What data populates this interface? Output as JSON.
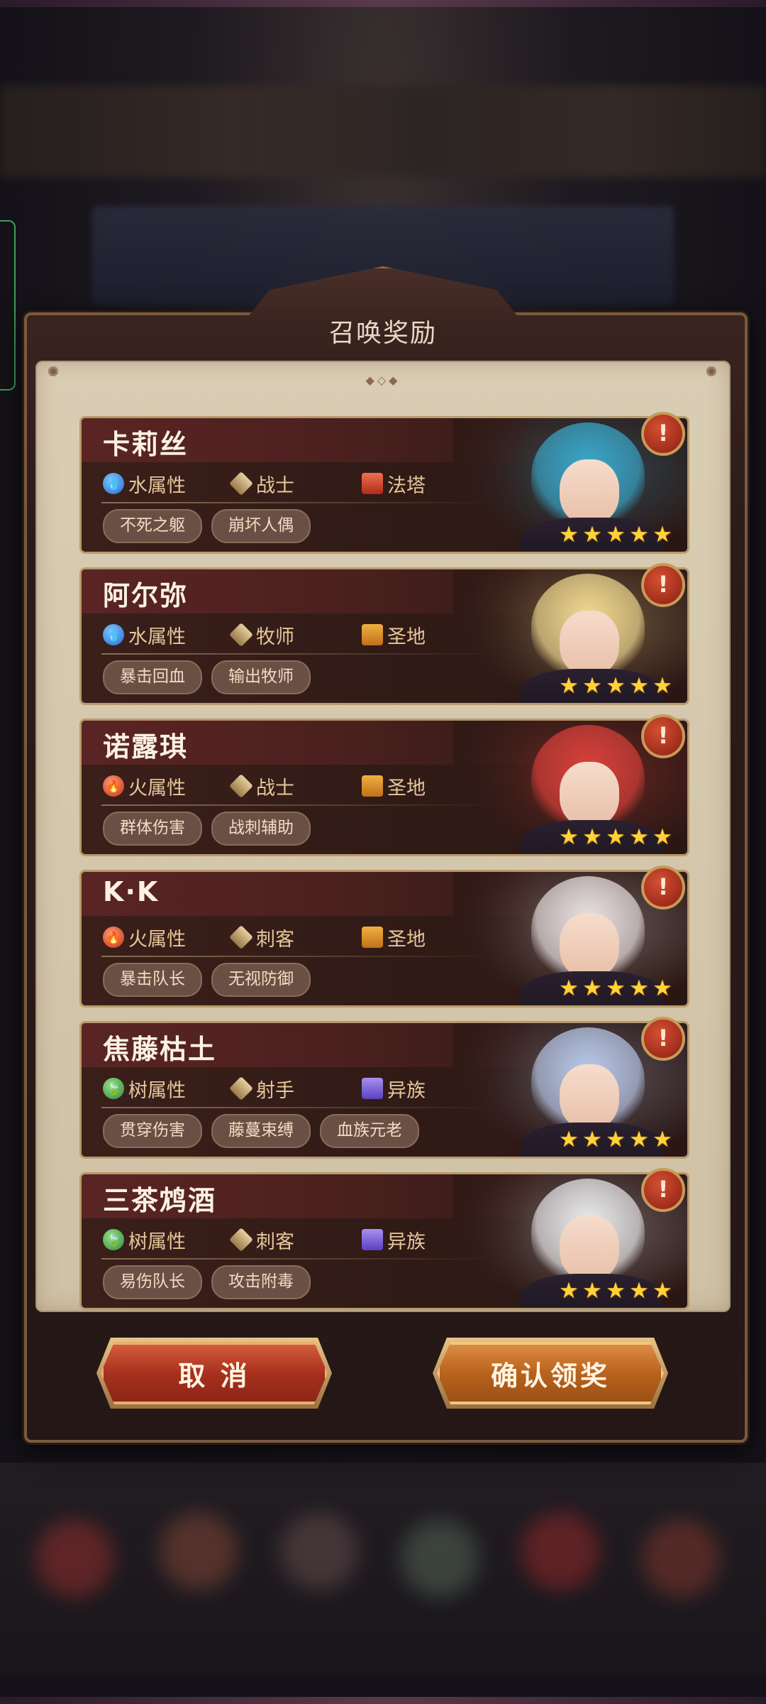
{
  "dialog": {
    "title": "召唤奖励",
    "cancel_label": "取 消",
    "confirm_label": "确认领奖"
  },
  "heroes": [
    {
      "name": "卡莉丝",
      "element": {
        "label": "水属性",
        "icon": "water-icon"
      },
      "class": {
        "label": "战士",
        "icon": "warrior-class-icon"
      },
      "faction": {
        "label": "法塔",
        "icon": "fata-faction-icon"
      },
      "tags": [
        "不死之躯",
        "崩坏人偶"
      ],
      "stars": 5,
      "hair_color": "#3aa6c8"
    },
    {
      "name": "阿尔弥",
      "element": {
        "label": "水属性",
        "icon": "water-icon"
      },
      "class": {
        "label": "牧师",
        "icon": "priest-class-icon"
      },
      "faction": {
        "label": "圣地",
        "icon": "holy-land-faction-icon"
      },
      "tags": [
        "暴击回血",
        "输出牧师"
      ],
      "stars": 5,
      "hair_color": "#f0d890"
    },
    {
      "name": "诺露琪",
      "element": {
        "label": "火属性",
        "icon": "fire-icon"
      },
      "class": {
        "label": "战士",
        "icon": "warrior-class-icon"
      },
      "faction": {
        "label": "圣地",
        "icon": "holy-land-faction-icon"
      },
      "tags": [
        "群体伤害",
        "战刺辅助"
      ],
      "stars": 5,
      "hair_color": "#d8403a"
    },
    {
      "name": "K·K",
      "element": {
        "label": "火属性",
        "icon": "fire-icon"
      },
      "class": {
        "label": "刺客",
        "icon": "assassin-class-icon"
      },
      "faction": {
        "label": "圣地",
        "icon": "holy-land-faction-icon"
      },
      "tags": [
        "暴击队长",
        "无视防御"
      ],
      "stars": 5,
      "hair_color": "#e8e0e0"
    },
    {
      "name": "焦藤枯土",
      "element": {
        "label": "树属性",
        "icon": "wood-icon"
      },
      "class": {
        "label": "射手",
        "icon": "archer-class-icon"
      },
      "faction": {
        "label": "异族",
        "icon": "alien-faction-icon"
      },
      "tags": [
        "贯穿伤害",
        "藤蔓束缚",
        "血族元老"
      ],
      "stars": 5,
      "hair_color": "#b8c8e8"
    },
    {
      "name": "三茶鸩酒",
      "element": {
        "label": "树属性",
        "icon": "wood-icon"
      },
      "class": {
        "label": "刺客",
        "icon": "assassin-class-icon"
      },
      "faction": {
        "label": "异族",
        "icon": "alien-faction-icon"
      },
      "tags": [
        "易伤队长",
        "攻击附毒"
      ],
      "stars": 5,
      "hair_color": "#e8e8ea"
    }
  ],
  "colors": {
    "panel": "#d9cdb4",
    "card": "#2f1a16",
    "accent_gold": "#e6c79a",
    "star": "#ffd23a"
  }
}
